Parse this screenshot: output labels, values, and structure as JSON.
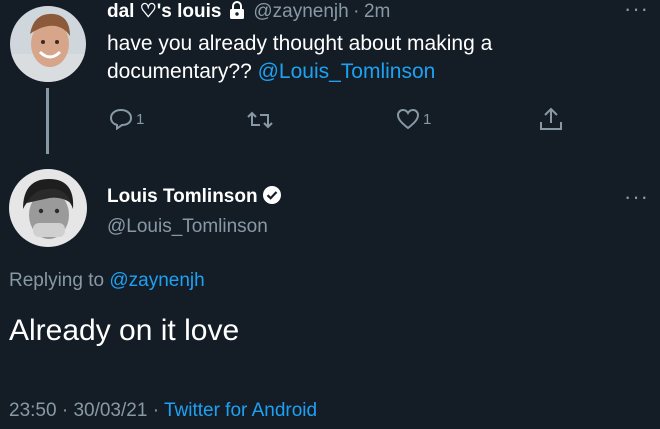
{
  "reply_tweet": {
    "display_name": "dal ♡'s louis",
    "handle": "@zaynenjh",
    "separator": "·",
    "time": "2m",
    "text_line1": "have you already thought about making a",
    "text_line2_prefix": "documentary?? ",
    "mention": "@Louis_Tomlinson",
    "reply_count": "1",
    "like_count": "1",
    "icons": [
      "lock-icon",
      "reply-icon",
      "retweet-icon",
      "like-icon",
      "share-icon",
      "more-icon"
    ]
  },
  "main_tweet": {
    "display_name": "Louis Tomlinson",
    "handle": "@Louis_Tomlinson",
    "replying_to_label": "Replying to ",
    "replying_to_handle": "@zaynenjh",
    "text": "Already on it love",
    "time": "23:50",
    "sep1": "·",
    "date": "30/03/21",
    "sep2": "·",
    "source": "Twitter for Android",
    "icons": [
      "verified-icon",
      "more-icon"
    ]
  },
  "colors": {
    "background": "#141d26",
    "text": "#ffffff",
    "muted": "#8899a6",
    "link": "#1da1f2"
  }
}
